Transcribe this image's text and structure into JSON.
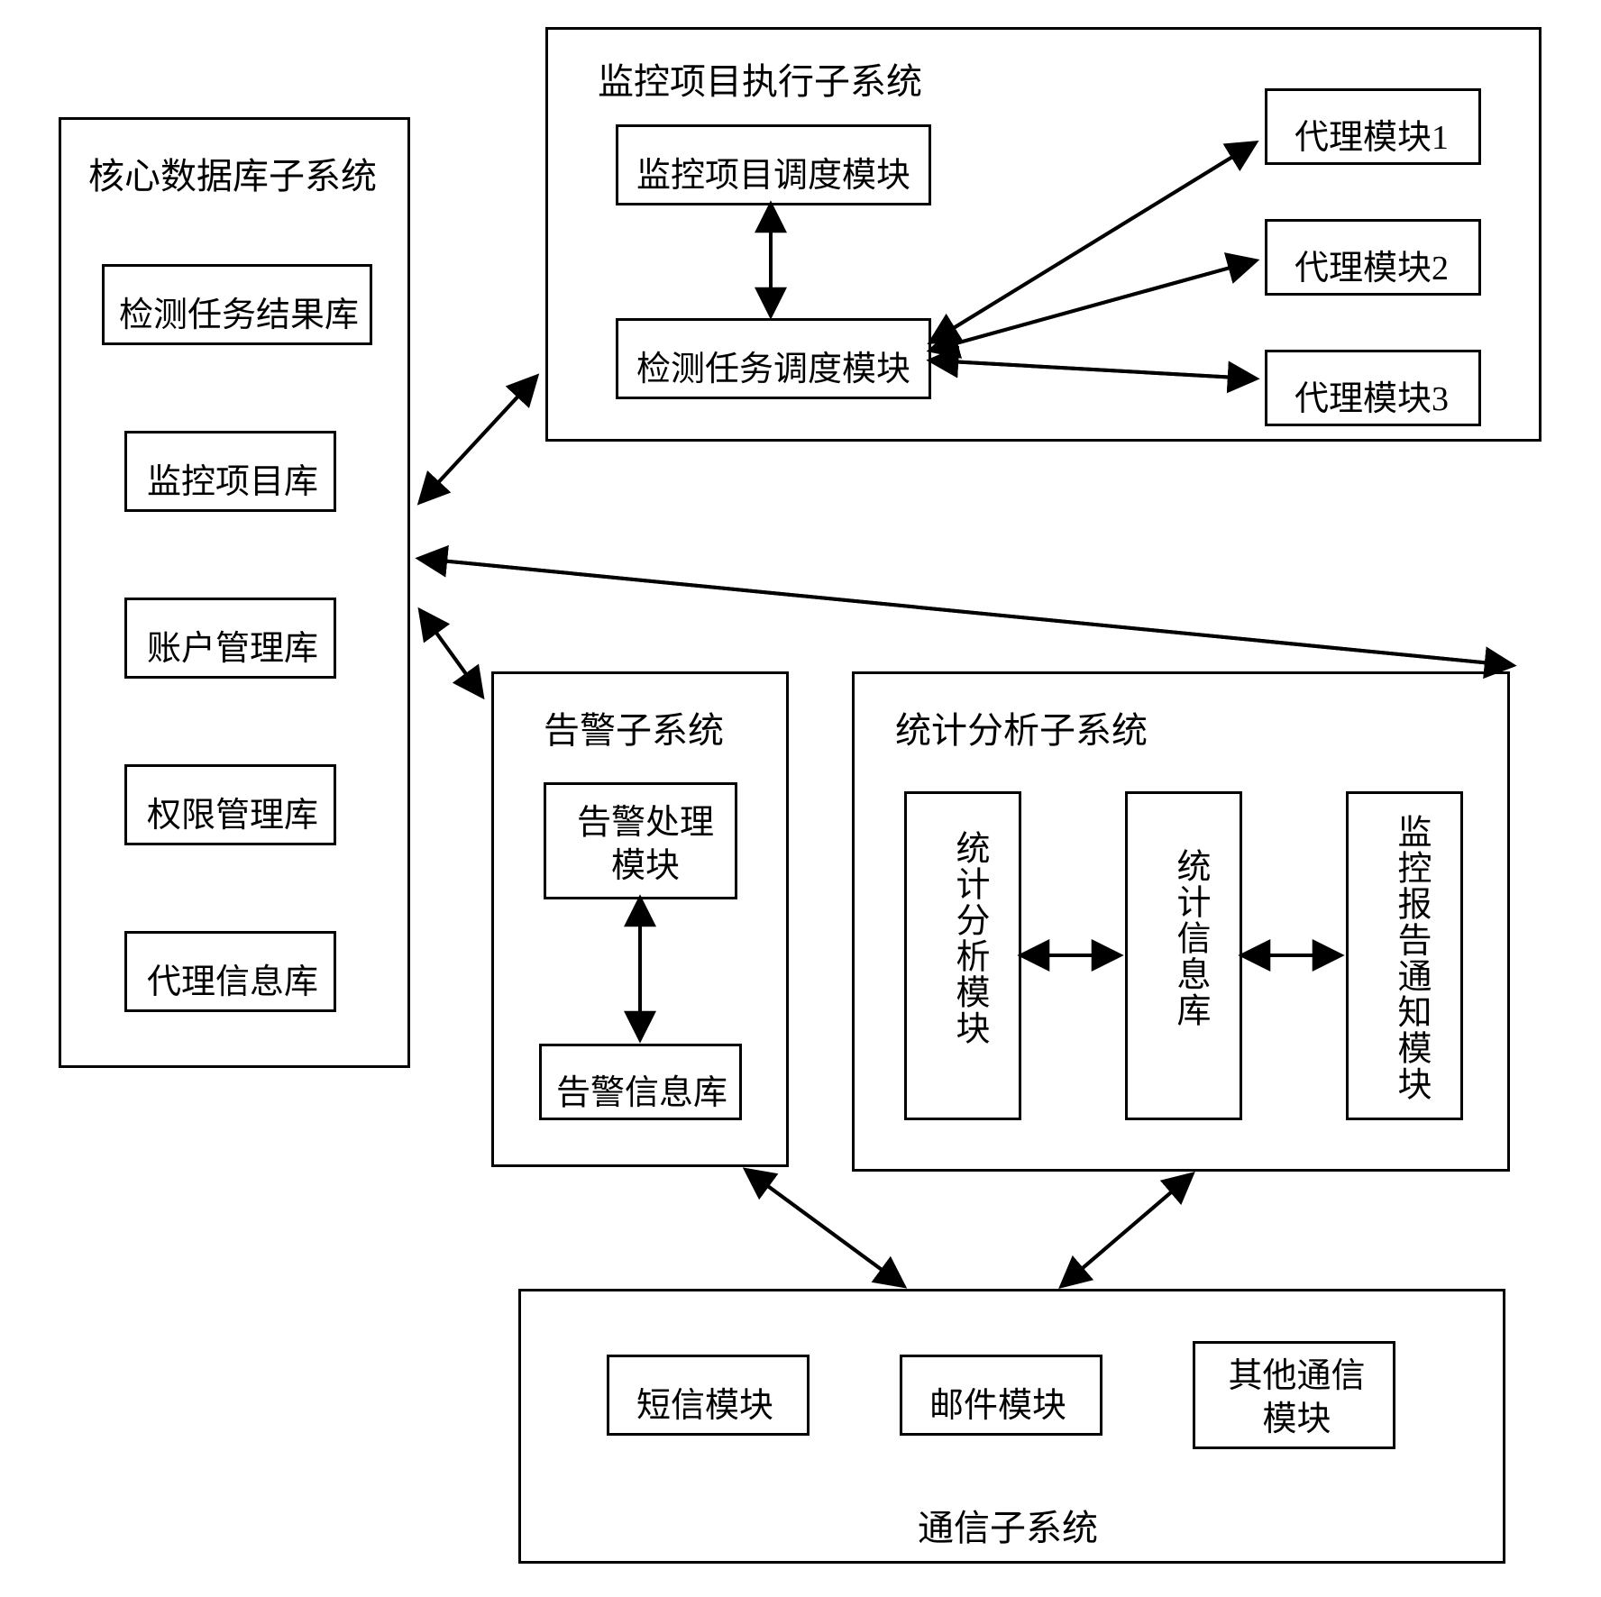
{
  "coreDb": {
    "title": "核心数据库子系统",
    "items": [
      "检测任务结果库",
      "监控项目库",
      "账户管理库",
      "权限管理库",
      "代理信息库"
    ]
  },
  "exec": {
    "title": "监控项目执行子系统",
    "sched1": "监控项目调度模块",
    "sched2": "检测任务调度模块",
    "agents": [
      "代理模块1",
      "代理模块2",
      "代理模块3"
    ]
  },
  "alarm": {
    "title": "告警子系统",
    "proc": "告警处理模块",
    "store": "告警信息库"
  },
  "stats": {
    "title": "统计分析子系统",
    "mod1": "统计分析模块",
    "mod2": "统计信息库",
    "mod3": "监控报告通知模块"
  },
  "comm": {
    "title": "通信子系统",
    "mods": [
      "短信模块",
      "邮件模块",
      "其他通信模块"
    ]
  }
}
